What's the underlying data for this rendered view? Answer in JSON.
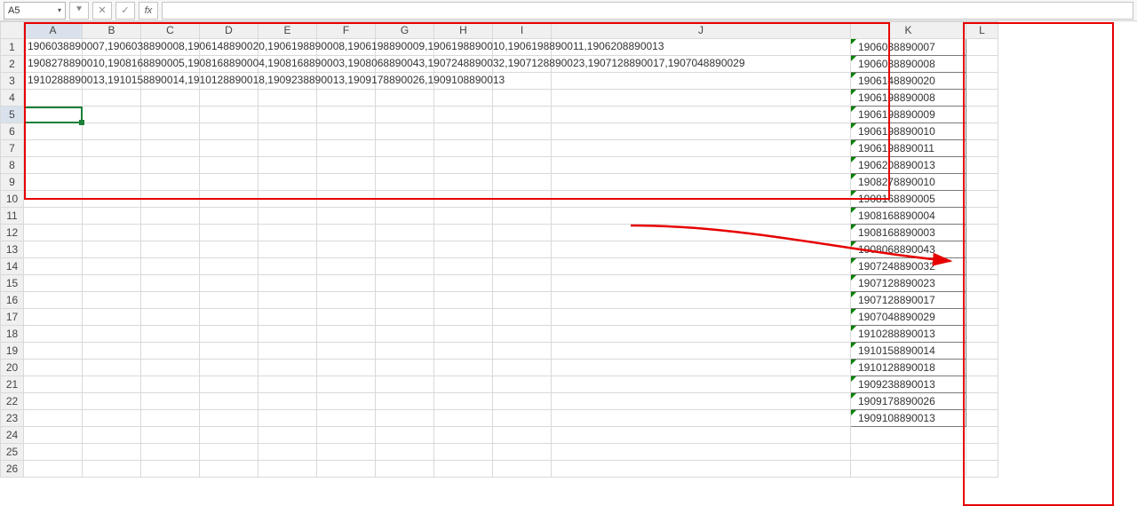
{
  "name_box": {
    "value": "A5"
  },
  "formula_bar": {
    "expand": "⯆",
    "cancel": "✕",
    "confirm": "✓",
    "fx": "fx",
    "value": ""
  },
  "columns": [
    "A",
    "B",
    "C",
    "D",
    "E",
    "F",
    "G",
    "H",
    "I",
    "J",
    "K",
    "L"
  ],
  "col_widths": {
    "A": 66,
    "B": 66,
    "C": 66,
    "D": 66,
    "E": 66,
    "F": 66,
    "G": 66,
    "H": 66,
    "I": 66,
    "J": 337,
    "K": 130,
    "L": 36
  },
  "rows": 26,
  "active_cell": "A5",
  "long_rows": {
    "1": "1906038890007,1906038890008,1906148890020,1906198890008,1906198890009,1906198890010,1906198890011,1906208890013",
    "2": "1908278890010,1908168890005,1908168890004,1908168890003,1908068890043,1907248890032,1907128890023,1907128890017,1907048890029",
    "3": "1910288890013,1910158890014,1910128890018,1909238890013,1909178890026,1909108890013"
  },
  "k_values": [
    "1906038890007",
    "1906038890008",
    "1906148890020",
    "1906198890008",
    "1906198890009",
    "1906198890010",
    "1906198890011",
    "1906208890013",
    "1908278890010",
    "1908168890005",
    "1908168890004",
    "1908168890003",
    "1908068890043",
    "1907248890032",
    "1907128890023",
    "1907128890017",
    "1907048890029",
    "1910288890013",
    "1910158890014",
    "1910128890018",
    "1909238890013",
    "1909178890026",
    "1909108890013"
  ]
}
